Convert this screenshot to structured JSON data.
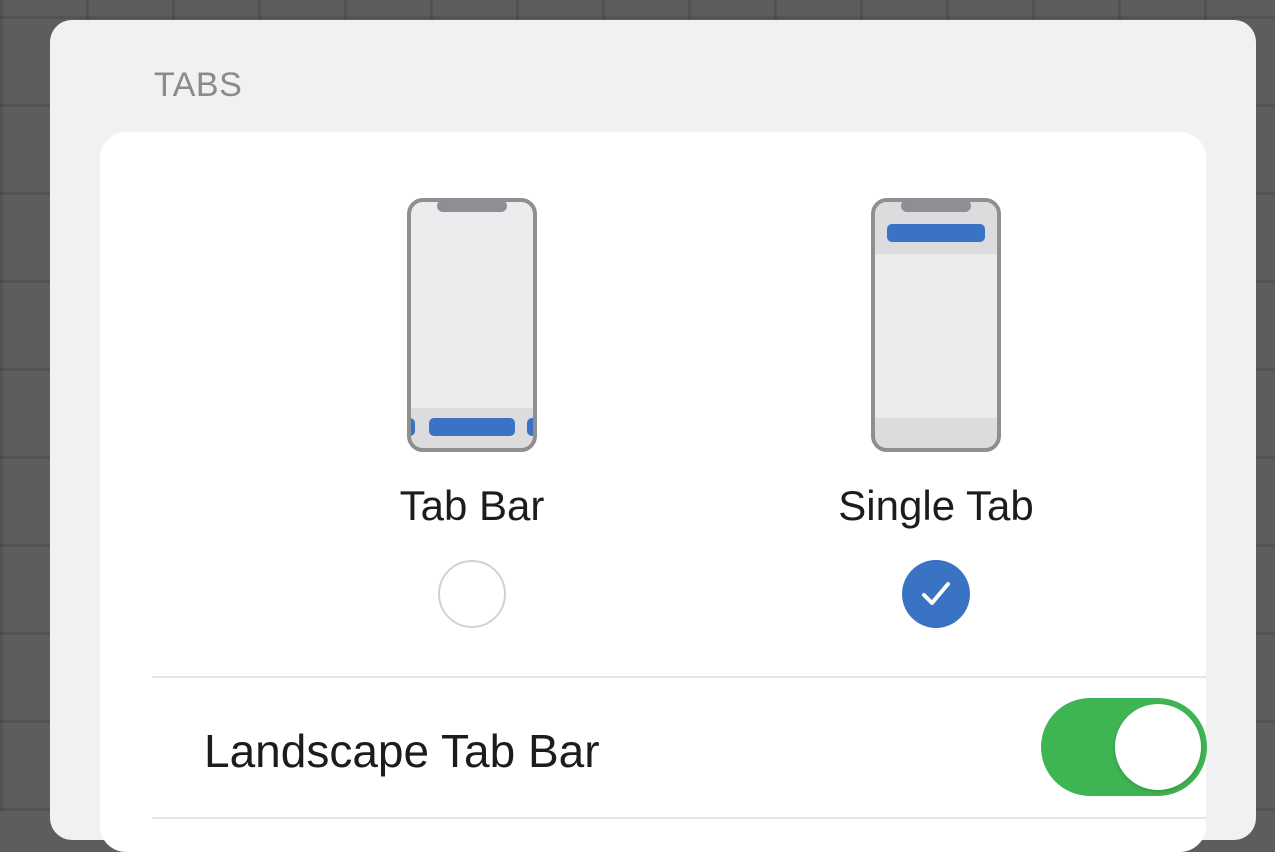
{
  "section": {
    "header": "TABS"
  },
  "options": [
    {
      "label": "Tab Bar",
      "selected": false,
      "icon": "phone-tab-bar-icon"
    },
    {
      "label": "Single Tab",
      "selected": true,
      "icon": "phone-single-tab-icon"
    }
  ],
  "landscape": {
    "label": "Landscape Tab Bar",
    "enabled": true
  },
  "colors": {
    "accent": "#3a73c4",
    "toggle_on": "#3fb453",
    "phone_frame": "#8e8e93",
    "phone_screen": "#ececee"
  }
}
